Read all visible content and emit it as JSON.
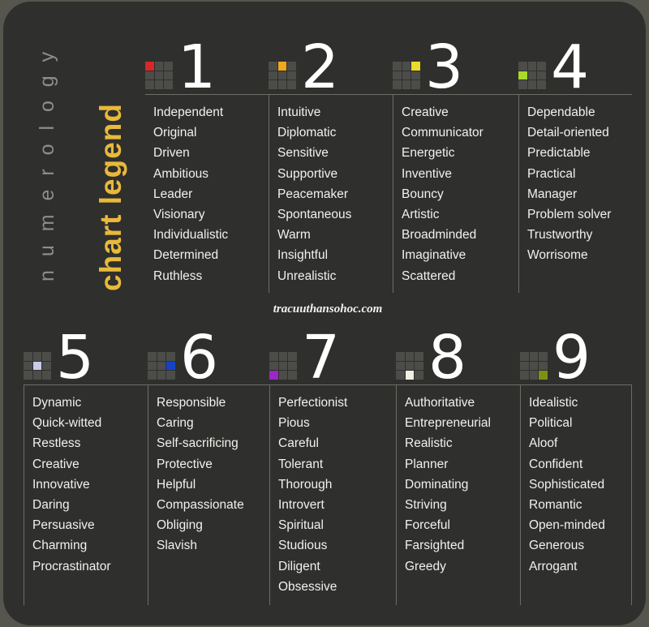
{
  "title": {
    "line1": "n u m e r o l o g y",
    "line2": "chart legend",
    "line1_color": "#8e8e88",
    "line2_color": "#e8b93b"
  },
  "watermark": "tracuuthansohoc.com",
  "colors": {
    "card_background": "#2f2f2d",
    "outer_background": "#56564f",
    "divider": "#6d6d67",
    "text": "#f1f1ee",
    "numeral": "#ffffff",
    "icon_cell": "#4c4c49"
  },
  "numbers": [
    {
      "numeral": "1",
      "icon_name": "grid-icon-1",
      "highlight_index": 0,
      "highlight_color": "#d62828",
      "traits": [
        "Independent",
        "Original",
        "Driven",
        "Ambitious",
        "Leader",
        "Visionary",
        "Individualistic",
        "Determined",
        "Ruthless"
      ]
    },
    {
      "numeral": "2",
      "icon_name": "grid-icon-2",
      "highlight_index": 1,
      "highlight_color": "#f0a81e",
      "traits": [
        "Intuitive",
        "Diplomatic",
        "Sensitive",
        "Supportive",
        "Peacemaker",
        "Spontaneous",
        "Warm",
        "Insightful",
        "Unrealistic"
      ]
    },
    {
      "numeral": "3",
      "icon_name": "grid-icon-3",
      "highlight_index": 2,
      "highlight_color": "#eada2a",
      "traits": [
        "Creative",
        "Communicator",
        "Energetic",
        "Inventive",
        "Bouncy",
        "Artistic",
        "Broadminded",
        "Imaginative",
        "Scattered"
      ]
    },
    {
      "numeral": "4",
      "icon_name": "grid-icon-4",
      "highlight_index": 3,
      "highlight_color": "#a8d82a",
      "traits": [
        "Dependable",
        "Detail-oriented",
        "Predictable",
        "Practical",
        "Manager",
        "Problem solver",
        "Trustworthy",
        "Worrisome"
      ]
    },
    {
      "numeral": "5",
      "icon_name": "grid-icon-5",
      "highlight_index": 4,
      "highlight_color": "#c9cbe8",
      "traits": [
        "Dynamic",
        "Quick-witted",
        "Restless",
        "Creative",
        "Innovative",
        "Daring",
        "Persuasive",
        "Charming",
        "Procrastinator"
      ]
    },
    {
      "numeral": "6",
      "icon_name": "grid-icon-6",
      "highlight_index": 5,
      "highlight_color": "#1543c8",
      "traits": [
        "Responsible",
        "Caring",
        "Self-sacrificing",
        "Protective",
        "Helpful",
        "Compassionate",
        "Obliging",
        "Slavish"
      ]
    },
    {
      "numeral": "7",
      "icon_name": "grid-icon-7",
      "highlight_index": 6,
      "highlight_color": "#9b27c4",
      "traits": [
        "Perfectionist",
        "Pious",
        "Careful",
        "Tolerant",
        "Thorough",
        "Introvert",
        "Spiritual",
        "Studious",
        "Diligent",
        "Obsessive"
      ]
    },
    {
      "numeral": "8",
      "icon_name": "grid-icon-8",
      "highlight_index": 7,
      "highlight_color": "#f2efe4",
      "traits": [
        "Authoritative",
        "Entrepreneurial",
        "Realistic",
        "Planner",
        "Dominating",
        "Striving",
        "Forceful",
        "Farsighted",
        "Greedy"
      ]
    },
    {
      "numeral": "9",
      "icon_name": "grid-icon-9",
      "highlight_index": 8,
      "highlight_color": "#7f8e15",
      "traits": [
        "Idealistic",
        "Political",
        "Aloof",
        "Confident",
        "Sophisticated",
        "Romantic",
        "Open-minded",
        "Generous",
        "Arrogant"
      ]
    }
  ]
}
